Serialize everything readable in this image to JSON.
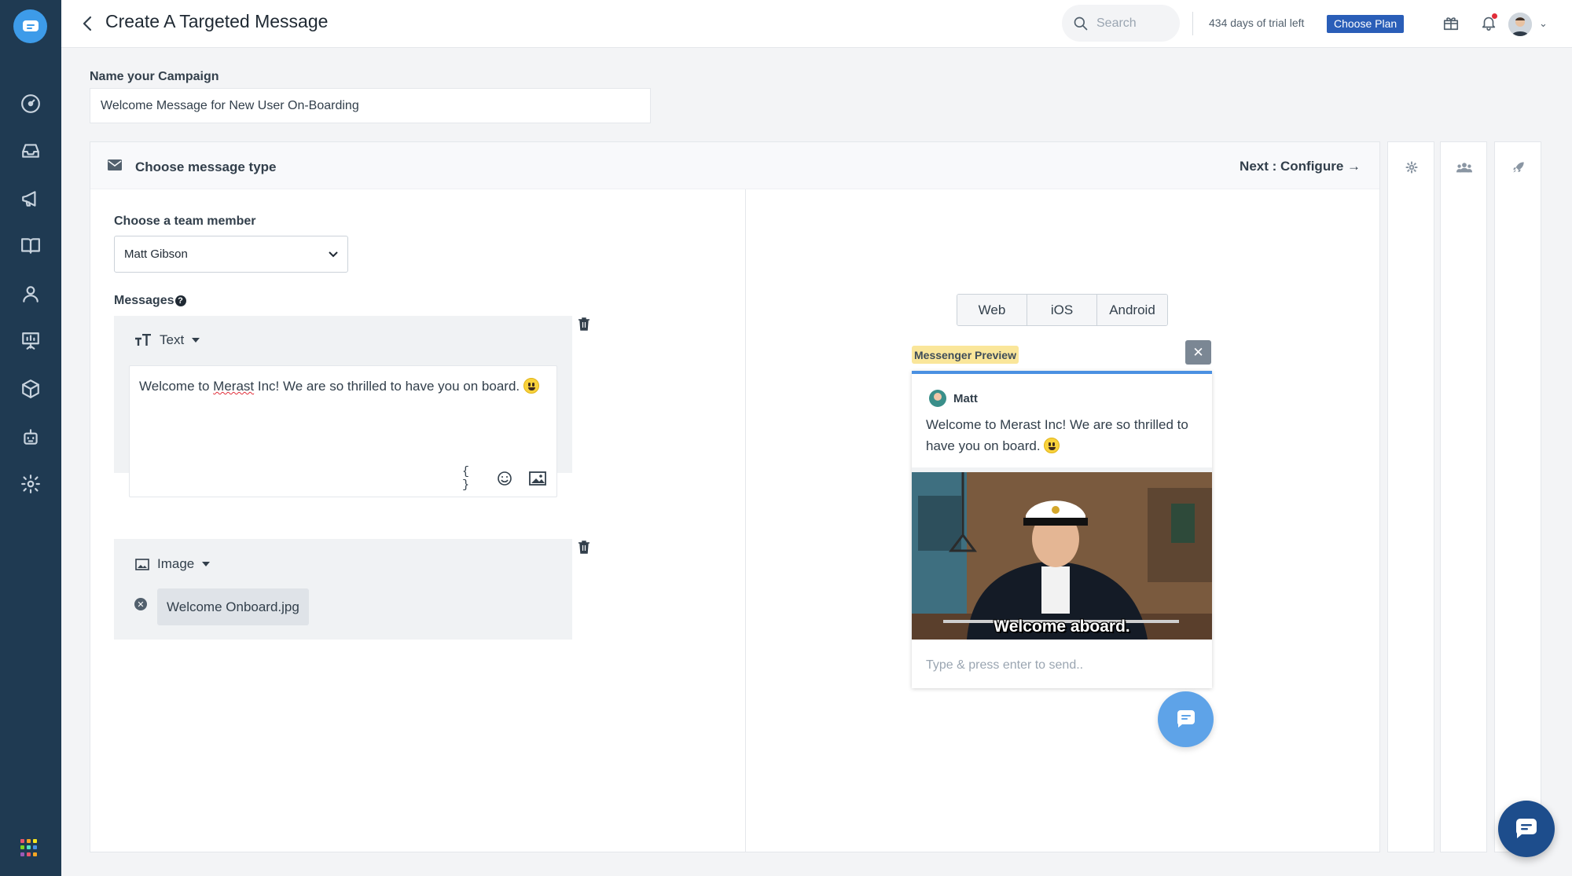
{
  "header": {
    "title": "Create A Targeted Message",
    "search_placeholder": "Search",
    "trial_text": "434 days of trial left",
    "choose_plan_label": "Choose Plan"
  },
  "sidebar": {
    "items": [
      {
        "icon": "dashboard-icon"
      },
      {
        "icon": "inbox-icon"
      },
      {
        "icon": "megaphone-icon"
      },
      {
        "icon": "book-icon"
      },
      {
        "icon": "user-icon"
      },
      {
        "icon": "presentation-icon"
      },
      {
        "icon": "box-icon"
      },
      {
        "icon": "bot-icon"
      },
      {
        "icon": "settings-icon"
      }
    ]
  },
  "campaign": {
    "label": "Name your Campaign",
    "value": "Welcome Message for New User On-Boarding"
  },
  "card": {
    "title": "Choose message type",
    "next_label": "Next : Configure →"
  },
  "form": {
    "team_label": "Choose a team member",
    "team_value": "Matt Gibson",
    "messages_label": "Messages",
    "text_block": {
      "type_label": "Text",
      "text_before": "Welcome to ",
      "text_spell": "Merast",
      "text_after": " Inc! We are so thrilled to have you on board. "
    },
    "image_block": {
      "type_label": "Image",
      "file_name": "Welcome Onboard.jpg"
    }
  },
  "preview": {
    "tabs": [
      "Web",
      "iOS",
      "Android"
    ],
    "badge": "Messenger Preview",
    "sender": "Matt",
    "message": "Welcome to Merast Inc! We are so thrilled to have you on board. ",
    "gif_caption": "Welcome aboard.",
    "reply_placeholder": "Type & press enter to send.."
  },
  "colors": {
    "sidebar": "#1f3a52",
    "accent": "#3d9be9",
    "plan_button": "#2a5eb8",
    "preview_border": "#4a90e2",
    "chat_fab": "#1d4d8c"
  }
}
